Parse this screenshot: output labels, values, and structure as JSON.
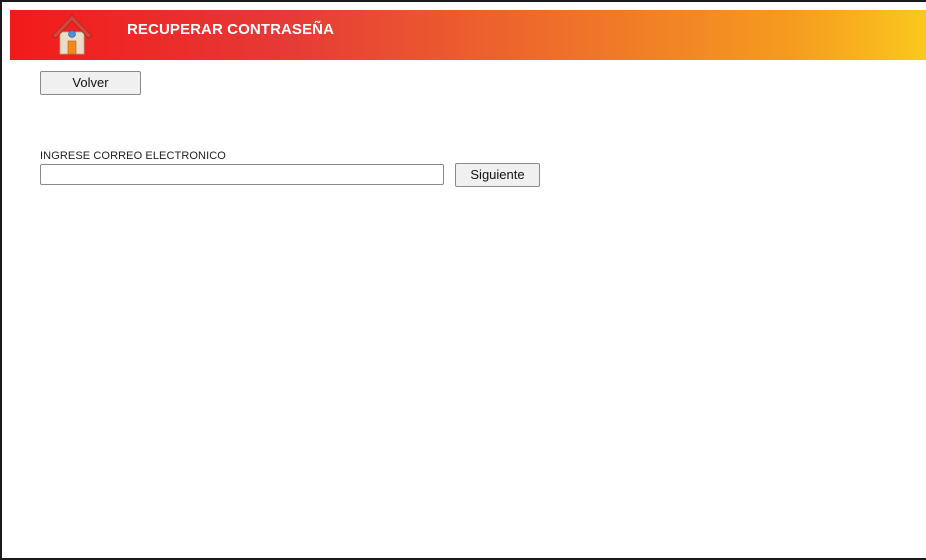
{
  "header": {
    "title": "RECUPERAR CONTRASEÑA",
    "icon": "home-icon",
    "gradient_colors": [
      "#f31a1a",
      "#e63a36",
      "#ee6f2a",
      "#f59b1f",
      "#fbc81d"
    ]
  },
  "actions": {
    "back_label": "Volver"
  },
  "form": {
    "email_label": "INGRESE CORREO ELECTRONICO",
    "email_value": "",
    "email_placeholder": "",
    "next_label": "Siguiente"
  }
}
